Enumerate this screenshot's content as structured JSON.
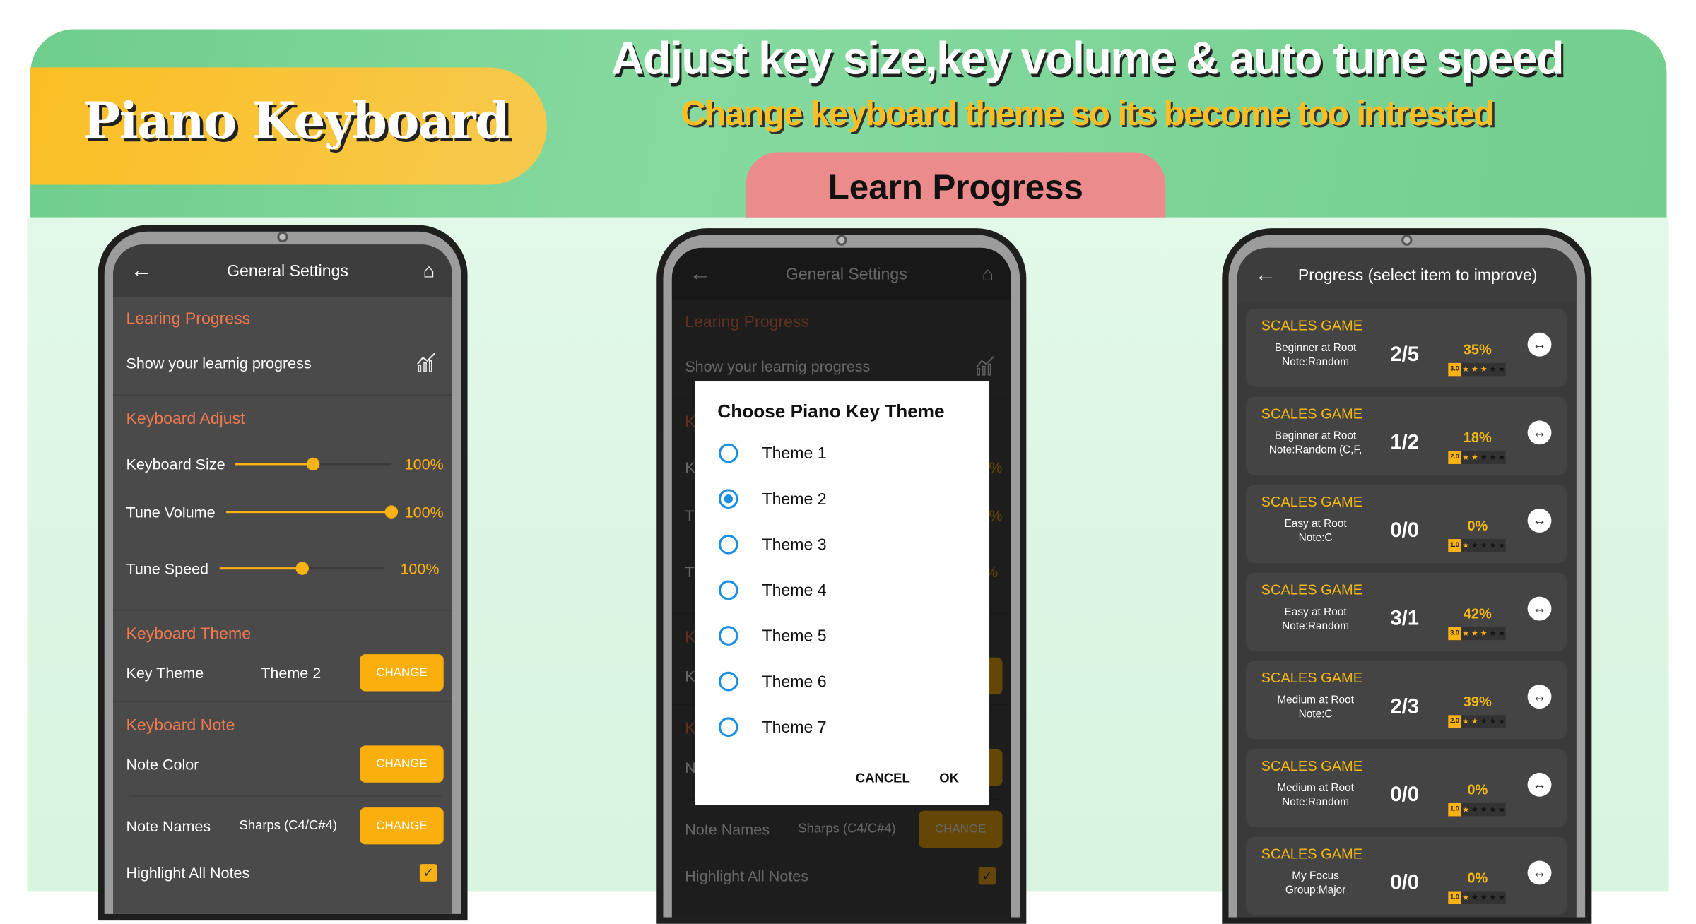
{
  "banner": {
    "brand": "Piano Keyboard",
    "headline": "Adjust key size,key volume & auto tune speed",
    "subheadline": "Change keyboard theme so its become too intrested",
    "tab": "Learn Progress"
  },
  "colors": {
    "accent": "#fbb214",
    "section": "#f07a50",
    "radio": "#1a8fe3",
    "banner_green": "#72cf8e",
    "pill_yellow": "#f7c744",
    "tab_pink": "#ec8b8b"
  },
  "settings": {
    "title": "General Settings",
    "back_icon": "arrow-left-icon",
    "home_icon": "home-icon",
    "learning_progress": "Learing Progress",
    "show_progress": "Show your learnig progress",
    "keyboard_adjust": "Keyboard Adjust",
    "keyboard_size": {
      "label": "Keyboard Size",
      "value": "100%",
      "level": 0.5
    },
    "tune_volume": {
      "label": "Tune Volume",
      "value": "100%",
      "level": 1.0
    },
    "tune_speed": {
      "label": "Tune Speed",
      "value": "100%",
      "level": 0.5
    },
    "keyboard_theme": "Keyboard Theme",
    "key_theme": "Key Theme",
    "key_theme_value": "Theme 2",
    "keyboard_note": "Keyboard Note",
    "note_color": "Note Color",
    "note_names": "Note Names",
    "note_names_value": "Sharps (C4/C#4)",
    "change": "CHANGE",
    "highlight": "Highlight All Notes",
    "highlight_checked": true
  },
  "dialog": {
    "title": "Choose Piano Key Theme",
    "options": [
      "Theme 1",
      "Theme 2",
      "Theme 3",
      "Theme 4",
      "Theme 5",
      "Theme 6",
      "Theme 7"
    ],
    "selected": "Theme 2",
    "cancel": "CANCEL",
    "ok": "OK"
  },
  "progress": {
    "title": "Progress (select item to improve)",
    "items": [
      {
        "game": "SCALES GAME",
        "line1": "Beginner at Root",
        "line2": "Note:Random",
        "score": "2/5",
        "percent": "35%",
        "rating": "3.0",
        "stars": 3
      },
      {
        "game": "SCALES GAME",
        "line1": "Beginner at Root",
        "line2": "Note:Random (C,F,",
        "score": "1/2",
        "percent": "18%",
        "rating": "2.0",
        "stars": 2
      },
      {
        "game": "SCALES GAME",
        "line1": "Easy at Root",
        "line2": "Note:C",
        "score": "0/0",
        "percent": "0%",
        "rating": "1.0",
        "stars": 1
      },
      {
        "game": "SCALES GAME",
        "line1": "Easy at Root",
        "line2": "Note:Random",
        "score": "3/1",
        "percent": "42%",
        "rating": "3.0",
        "stars": 3
      },
      {
        "game": "SCALES GAME",
        "line1": "Medium at Root",
        "line2": "Note:C",
        "score": "2/3",
        "percent": "39%",
        "rating": "2.0",
        "stars": 2
      },
      {
        "game": "SCALES GAME",
        "line1": "Medium at Root",
        "line2": "Note:Random",
        "score": "0/0",
        "percent": "0%",
        "rating": "1.0",
        "stars": 1
      },
      {
        "game": "SCALES GAME",
        "line1": "My Focus",
        "line2": "Group:Major",
        "score": "0/0",
        "percent": "0%",
        "rating": "1.0",
        "stars": 1
      }
    ]
  }
}
